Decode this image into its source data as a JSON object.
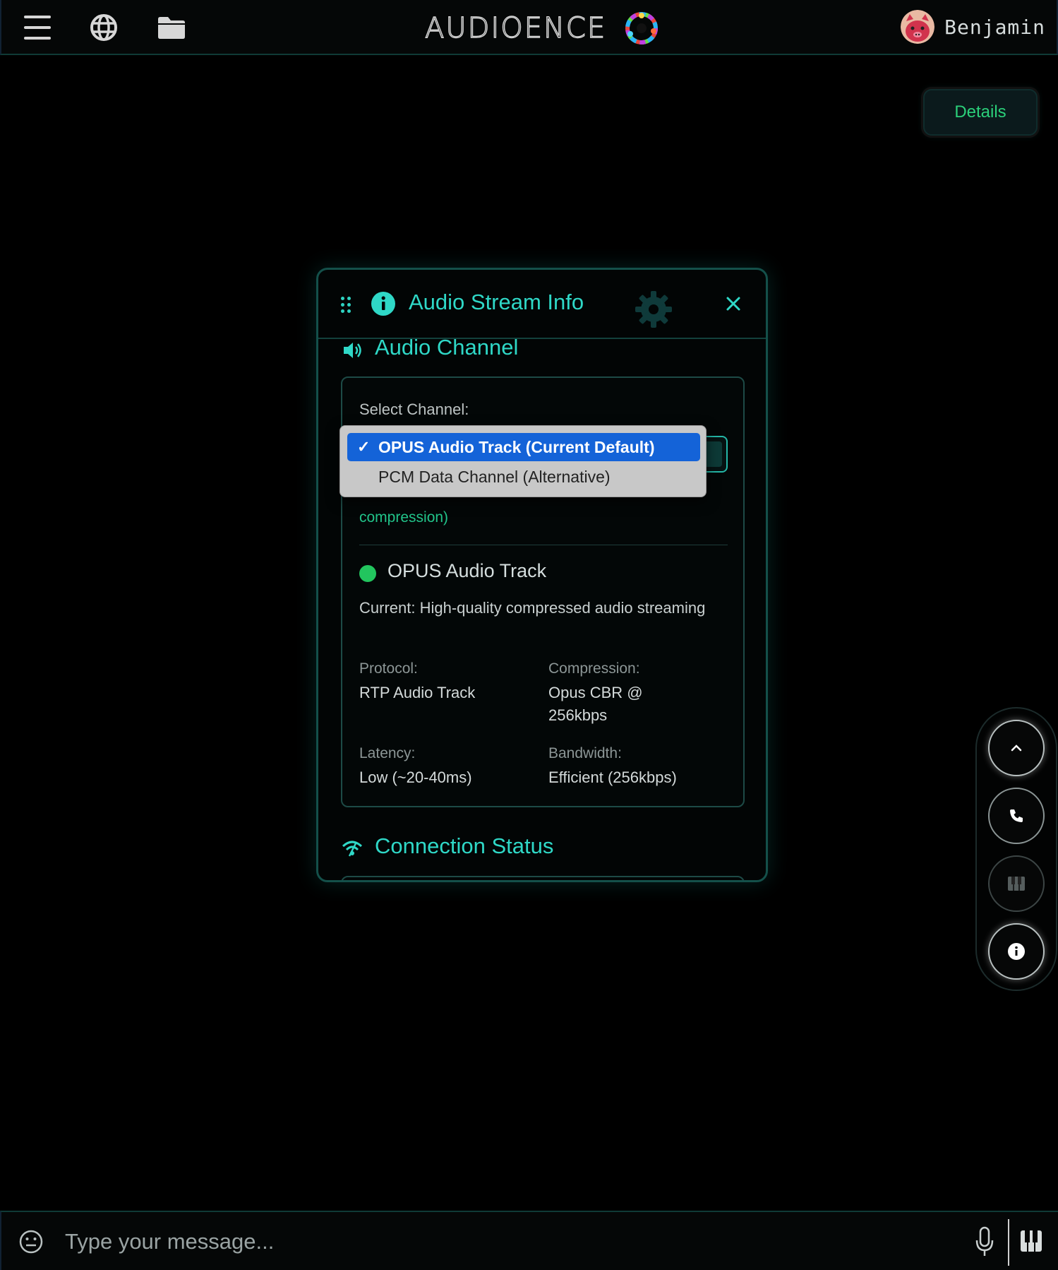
{
  "app": {
    "logo_text": "AUDIOENCE",
    "user_name": "Benjamin"
  },
  "header": {
    "menu_icon": "hamburger-menu-icon",
    "globe_icon": "globe-icon",
    "folder_icon": "folder-icon"
  },
  "details_button": {
    "label": "Details"
  },
  "modal": {
    "title": "Audio Stream Info",
    "audio_channel": {
      "heading": "Audio Channel",
      "select_label": "Select Channel:",
      "selected_value": "OPUS Audio Track (Current Default)",
      "options": [
        {
          "label": "OPUS Audio Track (Current Default)",
          "selected": true
        },
        {
          "label": "PCM Data Channel (Alternative)",
          "selected": false
        }
      ],
      "hint_visible_fragment": "compression)",
      "track": {
        "name": "OPUS Audio Track",
        "status_color": "#22c55e",
        "description": "Current: High-quality compressed audio streaming",
        "protocol_label": "Protocol:",
        "protocol_value": "RTP Audio Track",
        "compression_label": "Compression:",
        "compression_value": "Opus CBR @ 256kbps",
        "latency_label": "Latency:",
        "latency_value": "Low (~20-40ms)",
        "bandwidth_label": "Bandwidth:",
        "bandwidth_value": "Efficient (256kbps)"
      }
    },
    "connection_status": {
      "heading": "Connection Status"
    }
  },
  "floating_controls": [
    {
      "name": "collapse-button",
      "icon": "chevron-up-icon"
    },
    {
      "name": "call-button",
      "icon": "phone-icon"
    },
    {
      "name": "piano-button",
      "icon": "piano-keys-icon"
    },
    {
      "name": "info-button",
      "icon": "info-icon"
    }
  ],
  "message_bar": {
    "placeholder": "Type your message...",
    "emoji_icon": "emoji-icon",
    "mic_icon": "microphone-icon",
    "piano_icon": "piano-keys-icon"
  },
  "colors": {
    "accent": "#2fd8c7",
    "hint": "#22c48a",
    "details_text": "#2bd07a",
    "dropdown_highlight": "#1463d8"
  }
}
